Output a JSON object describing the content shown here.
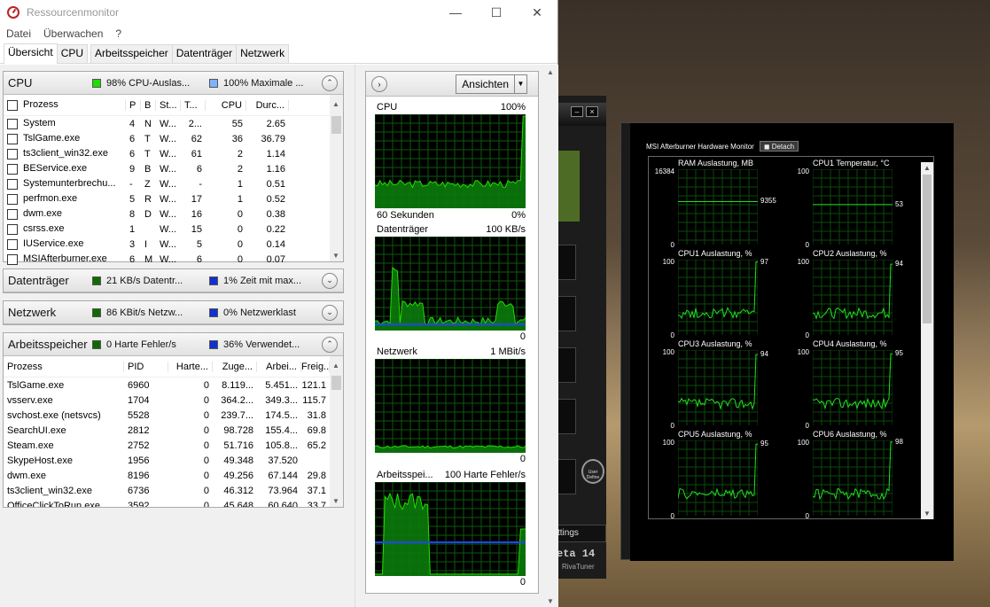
{
  "window": {
    "title": "Ressourcenmonitor"
  },
  "menu": [
    "Datei",
    "Überwachen",
    "?"
  ],
  "tabs": [
    "Übersicht",
    "CPU",
    "Arbeitsspeicher",
    "Datenträger",
    "Netzwerk"
  ],
  "cpu": {
    "title": "CPU",
    "stat1": "98% CPU-Auslas...",
    "stat2": "100% Maximale ...",
    "stat1_color": "#22dd00",
    "stat2_color": "#7fb2ff",
    "headers": [
      "Prozess",
      "P",
      "B",
      "St...",
      "T...",
      "CPU",
      "Durc..."
    ],
    "rows": [
      [
        "System",
        "4",
        "N",
        "W...",
        "2...",
        "55",
        "2.65"
      ],
      [
        "TslGame.exe",
        "6",
        "T",
        "W...",
        "62",
        "36",
        "36.79"
      ],
      [
        "ts3client_win32.exe",
        "6",
        "T",
        "W...",
        "61",
        "2",
        "1.14"
      ],
      [
        "BEService.exe",
        "9",
        "B",
        "W...",
        "6",
        "2",
        "1.16"
      ],
      [
        "Systemunterbrechu...",
        "-",
        "Z",
        "W...",
        "-",
        "1",
        "0.51"
      ],
      [
        "perfmon.exe",
        "5",
        "R",
        "W...",
        "17",
        "1",
        "0.52"
      ],
      [
        "dwm.exe",
        "8",
        "D",
        "W...",
        "16",
        "0",
        "0.38"
      ],
      [
        "csrss.exe",
        "1",
        "",
        "W...",
        "15",
        "0",
        "0.22"
      ],
      [
        "IUService.exe",
        "3",
        "I",
        "W...",
        "5",
        "0",
        "0.14"
      ],
      [
        "MSIAfterburner.exe",
        "6",
        "M",
        "W...",
        "6",
        "0",
        "0.07"
      ]
    ]
  },
  "disk": {
    "title": "Datenträger",
    "stat1": "21 KB/s Datentr...",
    "stat2": "1% Zeit mit max...",
    "stat1_color": "#0f6b00",
    "stat2_color": "#1030d0"
  },
  "network": {
    "title": "Netzwerk",
    "stat1": "86 KBit/s Netzw...",
    "stat2": "0% Netzwerklast",
    "stat1_color": "#0f6b00",
    "stat2_color": "#1030d0"
  },
  "memory": {
    "title": "Arbeitsspeicher",
    "stat1": "0 Harte Fehler/s",
    "stat2": "36% Verwendet...",
    "stat1_color": "#0f6b00",
    "stat2_color": "#1030d0",
    "headers": [
      "Prozess",
      "PID",
      "Harte...",
      "Zuge...",
      "Arbei...",
      "Freig..."
    ],
    "rows": [
      [
        "TslGame.exe",
        "6960",
        "0",
        "8.119...",
        "5.451...",
        "121.1"
      ],
      [
        "vsserv.exe",
        "1704",
        "0",
        "364.2...",
        "349.3...",
        "115.7"
      ],
      [
        "svchost.exe (netsvcs)",
        "5528",
        "0",
        "239.7...",
        "174.5...",
        "31.8"
      ],
      [
        "SearchUI.exe",
        "2812",
        "0",
        "98.728",
        "155.4...",
        "69.8"
      ],
      [
        "Steam.exe",
        "2752",
        "0",
        "51.716",
        "105.8...",
        "65.2"
      ],
      [
        "SkypeHost.exe",
        "1956",
        "0",
        "49.348",
        "37.520",
        ""
      ],
      [
        "dwm.exe",
        "8196",
        "0",
        "49.256",
        "67.144",
        "29.8"
      ],
      [
        "ts3client_win32.exe",
        "6736",
        "0",
        "46.312",
        "73.964",
        "37.1"
      ],
      [
        "OfficeClickToRun.exe",
        "3592",
        "0",
        "45.648",
        "60.640",
        "33.7"
      ]
    ]
  },
  "graphs": {
    "views_label": "Ansichten",
    "cpu": {
      "label": "CPU",
      "max": "100%",
      "time": "60 Sekunden",
      "min": "0%"
    },
    "disk": {
      "label": "Datenträger",
      "max": "100 KB/s",
      "min": "0"
    },
    "net": {
      "label": "Netzwerk",
      "max": "1 MBit/s",
      "min": "0"
    },
    "mem": {
      "label": "Arbeitsspei...",
      "max": "100 Harte Fehler/s",
      "min": "0"
    }
  },
  "afterburner": {
    "title": "MSI Afterburner Hardware Monitor",
    "detach": "Detach",
    "settings": "ttings",
    "beta": "eta 14",
    "riva": "RivaTuner",
    "user_define": "User Define",
    "graphs": [
      {
        "title": "RAM Auslastung, MB",
        "max": "16384",
        "min": "0",
        "current": "9355"
      },
      {
        "title": "CPU1 Temperatur, °C",
        "max": "100",
        "min": "0",
        "current": "53"
      },
      {
        "title": "CPU1 Auslastung, %",
        "max": "100",
        "min": "0",
        "current": "97"
      },
      {
        "title": "CPU2 Auslastung, %",
        "max": "100",
        "min": "0",
        "current": "94"
      },
      {
        "title": "CPU3 Auslastung, %",
        "max": "100",
        "min": "0",
        "current": "94"
      },
      {
        "title": "CPU4 Auslastung, %",
        "max": "100",
        "min": "0",
        "current": "95"
      },
      {
        "title": "CPU5 Auslastung, %",
        "max": "100",
        "min": "0",
        "current": "95"
      },
      {
        "title": "CPU6 Auslastung, %",
        "max": "100",
        "min": "0",
        "current": "98"
      }
    ]
  }
}
